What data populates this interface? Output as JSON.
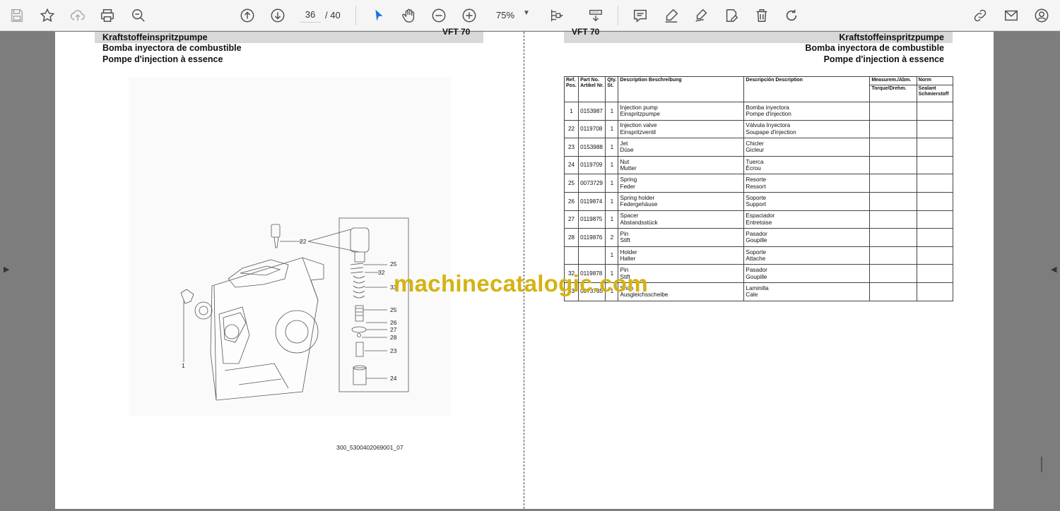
{
  "toolbar": {
    "page_current": "36",
    "page_total": "/ 40",
    "zoom": "75%",
    "icons": [
      "save-icon",
      "bookmark-star-icon",
      "upload-icon",
      "print-icon",
      "find-icon",
      "prev-page-icon",
      "next-page-icon",
      "select-cursor-icon",
      "hand-tool-icon",
      "zoom-out-icon",
      "zoom-in-icon",
      "page-fit-icon",
      "scroll-mode-icon",
      "comment-icon",
      "highlight-pen-icon",
      "sign-icon",
      "edit-pdf-icon",
      "delete-icon",
      "rotate-icon",
      "link-icon",
      "mail-icon",
      "account-icon"
    ]
  },
  "left_page": {
    "header_de": "Kraftstoffeinspritzpumpe",
    "header_es": "Bomba inyectora de combustible",
    "header_fr": "Pompe d'injection à essence",
    "model_code": "VFT 70",
    "figure_id": "300_5300402069001_07",
    "callouts": [
      "22",
      "25",
      "32",
      "33",
      "25",
      "26",
      "27",
      "28",
      "23",
      "24",
      "1"
    ]
  },
  "right_page": {
    "model_code": "VFT 70",
    "header_de": "Kraftstoffeinspritzpumpe",
    "header_es": "Bomba inyectora de combustible",
    "header_fr": "Pompe d'injection à essence",
    "table": {
      "headers": {
        "ref": "Ref. Pos.",
        "part": "Part No. Artikel Nr.",
        "qty": "Qty. St.",
        "desc": "Description Beschreibung",
        "desc2": "Descripción Description",
        "meas": "Measurem./Abm.",
        "meas_sub": "Torque/Drehm.",
        "norm": "Norm",
        "norm_sub": "Sealant Schmierstoff"
      },
      "rows": [
        {
          "ref": "1",
          "part": "0153987",
          "qty": "1",
          "en": "Injection pump",
          "de": "Einspritzpumpe",
          "es": "Bomba inyectora",
          "fr": "Pompe d'injection"
        },
        {
          "ref": "22",
          "part": "0119708",
          "qty": "1",
          "en": "Injection valve",
          "de": "Einspritzventil",
          "es": "Válvula Inyectora",
          "fr": "Soupape d'injection"
        },
        {
          "ref": "23",
          "part": "0153988",
          "qty": "1",
          "en": "Jet",
          "de": "Düse",
          "es": "Chicler",
          "fr": "Gicleur"
        },
        {
          "ref": "24",
          "part": "0119709",
          "qty": "1",
          "en": "Nut",
          "de": "Mutter",
          "es": "Tuerca",
          "fr": "Écrou"
        },
        {
          "ref": "25",
          "part": "0073729",
          "qty": "1",
          "en": "Spring",
          "de": "Feder",
          "es": "Resorte",
          "fr": "Ressort"
        },
        {
          "ref": "26",
          "part": "0119874",
          "qty": "1",
          "en": "Spring holder",
          "de": "Federgehäuse",
          "es": "Soporte",
          "fr": "Support"
        },
        {
          "ref": "27",
          "part": "0119875",
          "qty": "1",
          "en": "Spacer",
          "de": "Abstandsstück",
          "es": "Espaciador",
          "fr": "Entretoise"
        },
        {
          "ref": "28",
          "part": "0119876",
          "qty": "2",
          "en": "Pin",
          "de": "Stift",
          "es": "Pasador",
          "fr": "Goupille"
        },
        {
          "ref": "",
          "part": "",
          "qty": "1",
          "en": "Holder",
          "de": "Halter",
          "es": "Soporte",
          "fr": "Attache"
        },
        {
          "ref": "32",
          "part": "0119878",
          "qty": "1",
          "en": "Pin",
          "de": "Stift",
          "es": "Pasador",
          "fr": "Goupille"
        },
        {
          "ref": "33",
          "part": "0073735",
          "qty": "1",
          "en": "Shim",
          "de": "Ausgleichsscheibe",
          "es": "Laminilla",
          "fr": "Cale"
        }
      ]
    }
  },
  "watermark": "machinecatalogic.com"
}
